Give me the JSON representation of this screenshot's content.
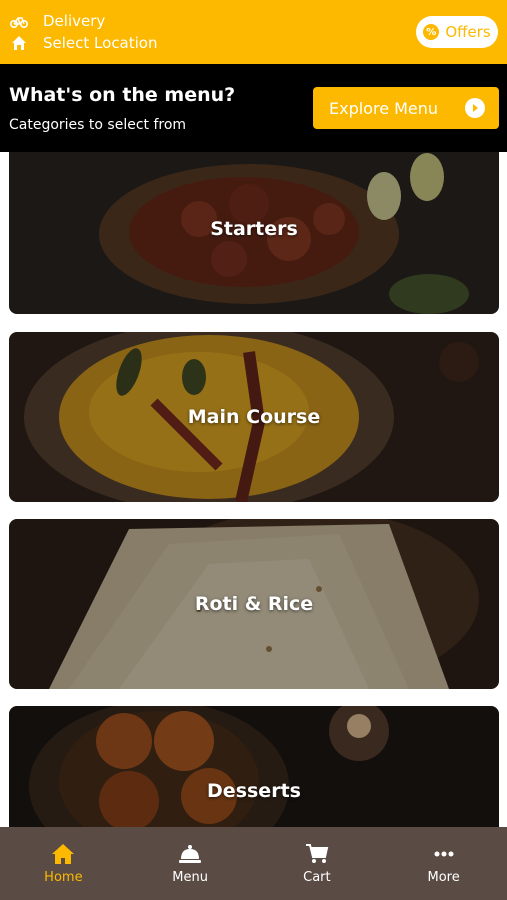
{
  "header": {
    "mode_label": "Delivery",
    "location_label": "Select Location",
    "offers_label": "Offers",
    "mode_icon": "bicycle-icon",
    "location_icon": "home-icon",
    "accent_color": "#FCB900"
  },
  "menu_header": {
    "title": "What's on the menu?",
    "subtitle": "Categories to select from",
    "explore_label": "Explore Menu"
  },
  "categories": [
    {
      "label": "Starters"
    },
    {
      "label": "Main Course"
    },
    {
      "label": "Roti & Rice"
    },
    {
      "label": "Desserts"
    }
  ],
  "tabbar": {
    "tabs": [
      {
        "label": "Home",
        "icon": "home-icon",
        "active": true
      },
      {
        "label": "Menu",
        "icon": "cloche-icon",
        "active": false
      },
      {
        "label": "Cart",
        "icon": "cart-icon",
        "active": false
      },
      {
        "label": "More",
        "icon": "more-dots-icon",
        "active": false
      }
    ]
  }
}
